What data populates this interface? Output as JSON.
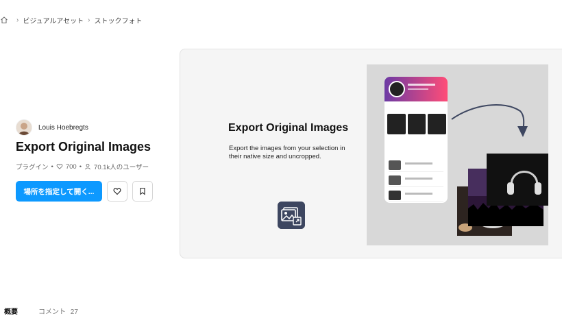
{
  "breadcrumb": {
    "items": [
      "ビジュアルアセット",
      "ストックフォト"
    ]
  },
  "author": {
    "name": "Louis Hoebregts"
  },
  "plugin": {
    "title": "Export Original Images",
    "type": "プラグイン",
    "likes": "700",
    "users": "70.1k人のユーザー"
  },
  "actions": {
    "open_label": "場所を指定して開く..."
  },
  "hero": {
    "title": "Export Original Images",
    "description": "Export the images from your selection in their native size and uncropped."
  },
  "tabs": [
    {
      "label": "概要",
      "count": ""
    },
    {
      "label": "コメント",
      "count": "27"
    }
  ],
  "colors": {
    "primary": "#0d99ff",
    "hero_bg": "#f5f5f5",
    "mock_bg": "#d8d8d8",
    "icon_bg": "#3d4660"
  }
}
